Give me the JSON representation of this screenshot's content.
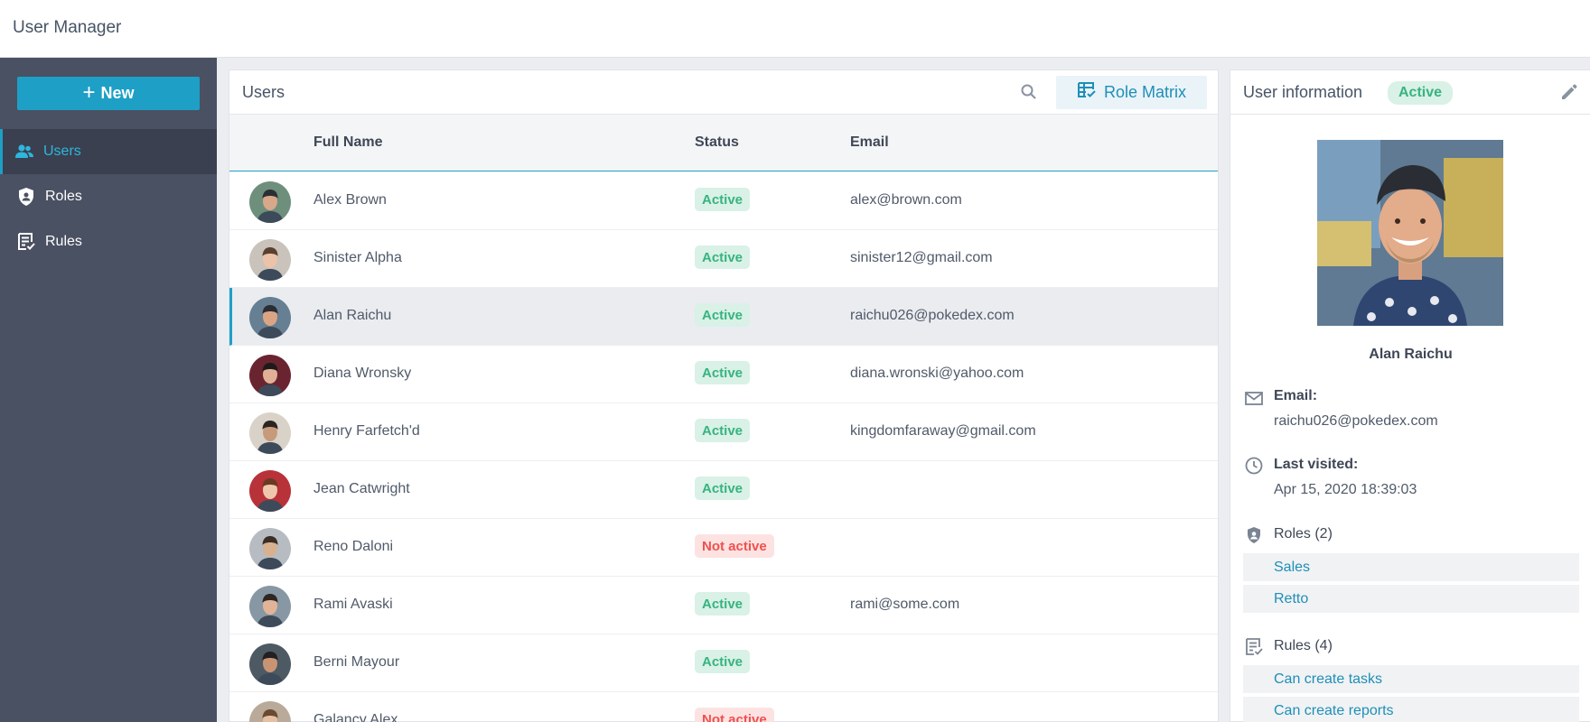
{
  "app": {
    "title": "User Manager"
  },
  "sidebar": {
    "new_button": {
      "label": "New",
      "icon": "plus-icon"
    },
    "items": [
      {
        "label": "Users",
        "icon": "users-icon",
        "active": true
      },
      {
        "label": "Roles",
        "icon": "shield-user-icon",
        "active": false
      },
      {
        "label": "Rules",
        "icon": "rules-list-icon",
        "active": false
      }
    ]
  },
  "users_panel": {
    "title": "Users",
    "search_icon": "search-icon",
    "role_matrix_button": {
      "label": "Role Matrix",
      "icon": "table-check-icon"
    },
    "columns": {
      "name": "Full Name",
      "status": "Status",
      "email": "Email"
    },
    "rows": [
      {
        "name": "Alex Brown",
        "status": "Active",
        "email": "alex@brown.com"
      },
      {
        "name": "Sinister Alpha",
        "status": "Active",
        "email": "sinister12@gmail.com"
      },
      {
        "name": "Alan Raichu",
        "status": "Active",
        "email": "raichu026@pokedex.com"
      },
      {
        "name": "Diana Wronsky",
        "status": "Active",
        "email": "diana.wronski@yahoo.com"
      },
      {
        "name": "Henry Farfetch'd",
        "status": "Active",
        "email": "kingdomfaraway@gmail.com"
      },
      {
        "name": "Jean Catwright",
        "status": "Active",
        "email": ""
      },
      {
        "name": "Reno Daloni",
        "status": "Not active",
        "email": ""
      },
      {
        "name": "Rami Avaski",
        "status": "Active",
        "email": "rami@some.com"
      },
      {
        "name": "Berni Mayour",
        "status": "Active",
        "email": ""
      },
      {
        "name": "Galancy Alex",
        "status": "Not active",
        "email": ""
      }
    ],
    "selected_index": 2
  },
  "info_panel": {
    "title": "User information",
    "status": "Active",
    "edit_icon": "pencil-icon",
    "name": "Alan Raichu",
    "email_label": "Email:",
    "email": "raichu026@pokedex.com",
    "last_visited_label": "Last visited:",
    "last_visited": "Apr 15, 2020 18:39:03",
    "roles_label": "Roles (2)",
    "roles": [
      "Sales",
      "Retto"
    ],
    "rules_label": "Rules (4)",
    "rules": [
      "Can create tasks",
      "Can create reports"
    ]
  },
  "colors": {
    "accent": "#1ea0c6",
    "sidebar_bg": "#4a5162",
    "active_badge_bg": "#d9f1e6",
    "active_badge_text": "#37b380",
    "inactive_badge_bg": "#fde2e2",
    "inactive_badge_text": "#f0504f"
  }
}
